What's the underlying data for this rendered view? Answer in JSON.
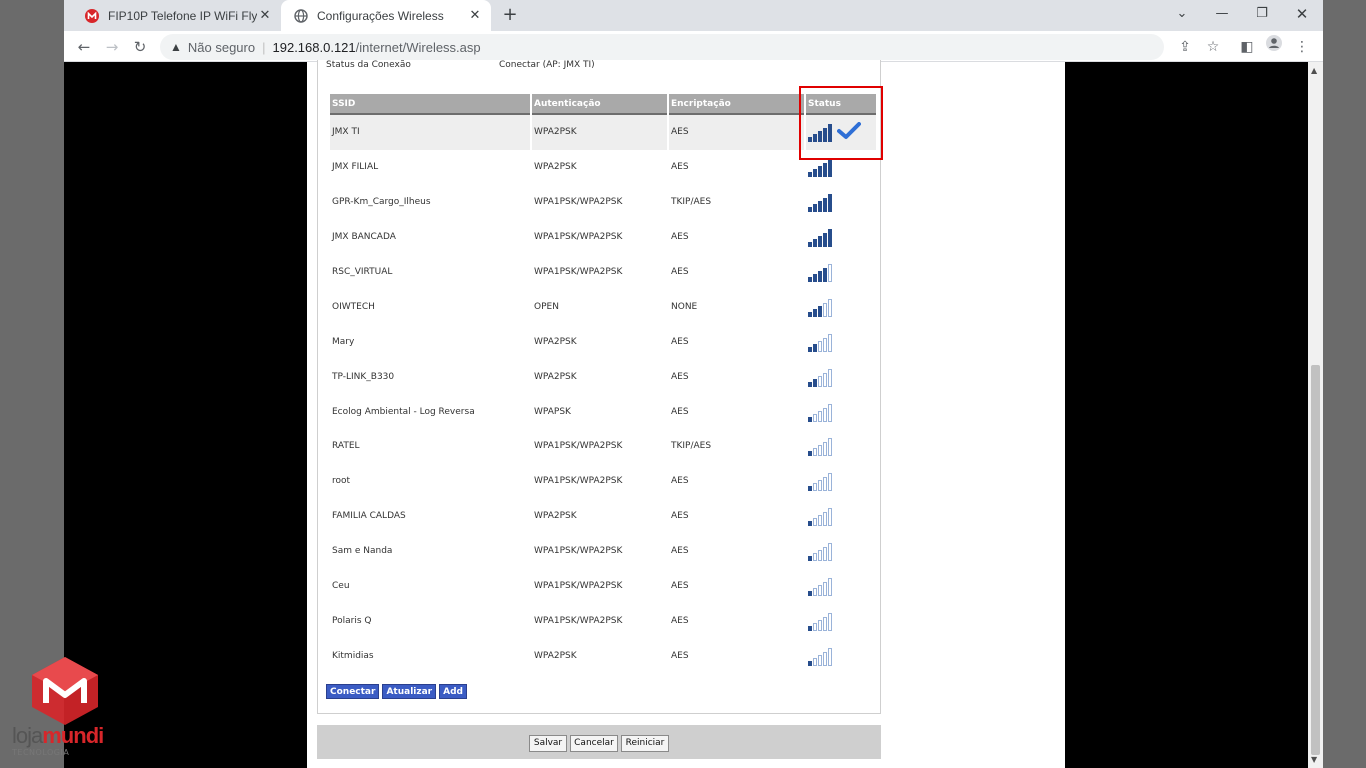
{
  "browser": {
    "tabs": [
      {
        "title": "FIP10P Telefone IP WiFi Flyingvoi",
        "active": false
      },
      {
        "title": "Configurações Wireless",
        "active": true
      }
    ],
    "address": {
      "security": "Não seguro",
      "host": "192.168.0.121",
      "path": "/internet/Wireless.asp"
    }
  },
  "page": {
    "status_label": "Status da Conexão",
    "status_value": "Conectar (AP: JMX TI)",
    "columns": [
      "SSID",
      "Autenticação",
      "Encriptação",
      "Status"
    ],
    "networks": [
      {
        "ssid": "JMX TI",
        "auth": "WPA2PSK",
        "enc": "AES",
        "signal": 5,
        "connected": true
      },
      {
        "ssid": "JMX FILIAL",
        "auth": "WPA2PSK",
        "enc": "AES",
        "signal": 5,
        "connected": false
      },
      {
        "ssid": "GPR-Km_Cargo_Ilheus",
        "auth": "WPA1PSK/WPA2PSK",
        "enc": "TKIP/AES",
        "signal": 5,
        "connected": false
      },
      {
        "ssid": "JMX BANCADA",
        "auth": "WPA1PSK/WPA2PSK",
        "enc": "AES",
        "signal": 5,
        "connected": false
      },
      {
        "ssid": "RSC_VIRTUAL",
        "auth": "WPA1PSK/WPA2PSK",
        "enc": "AES",
        "signal": 4,
        "connected": false
      },
      {
        "ssid": "OIWTECH",
        "auth": "OPEN",
        "enc": "NONE",
        "signal": 3,
        "connected": false
      },
      {
        "ssid": "Mary",
        "auth": "WPA2PSK",
        "enc": "AES",
        "signal": 2,
        "connected": false
      },
      {
        "ssid": "TP-LINK_B330",
        "auth": "WPA2PSK",
        "enc": "AES",
        "signal": 2,
        "connected": false
      },
      {
        "ssid": "Ecolog Ambiental - Log Reversa",
        "auth": "WPAPSK",
        "enc": "AES",
        "signal": 1,
        "connected": false
      },
      {
        "ssid": "RATEL",
        "auth": "WPA1PSK/WPA2PSK",
        "enc": "TKIP/AES",
        "signal": 1,
        "connected": false
      },
      {
        "ssid": "root",
        "auth": "WPA1PSK/WPA2PSK",
        "enc": "AES",
        "signal": 1,
        "connected": false
      },
      {
        "ssid": "FAMILIA CALDAS",
        "auth": "WPA2PSK",
        "enc": "AES",
        "signal": 1,
        "connected": false
      },
      {
        "ssid": "Sam e Nanda",
        "auth": "WPA1PSK/WPA2PSK",
        "enc": "AES",
        "signal": 1,
        "connected": false
      },
      {
        "ssid": "Ceu",
        "auth": "WPA1PSK/WPA2PSK",
        "enc": "AES",
        "signal": 1,
        "connected": false
      },
      {
        "ssid": "Polaris Q",
        "auth": "WPA1PSK/WPA2PSK",
        "enc": "AES",
        "signal": 1,
        "connected": false
      },
      {
        "ssid": "Kitmidias",
        "auth": "WPA2PSK",
        "enc": "AES",
        "signal": 1,
        "connected": false
      }
    ],
    "buttons": {
      "connect": "Conectar",
      "refresh": "Atualizar",
      "add": "Add"
    },
    "footer_buttons": {
      "save": "Salvar",
      "cancel": "Cancelar",
      "restart": "Reiniciar"
    }
  },
  "watermark": {
    "brand_a": "loja",
    "brand_b": "mundi",
    "sub": "TECNOLOGIA"
  },
  "colors": {
    "accent": "#3b5cc4",
    "signal": "#274d8c",
    "highlight": "#e00000"
  }
}
